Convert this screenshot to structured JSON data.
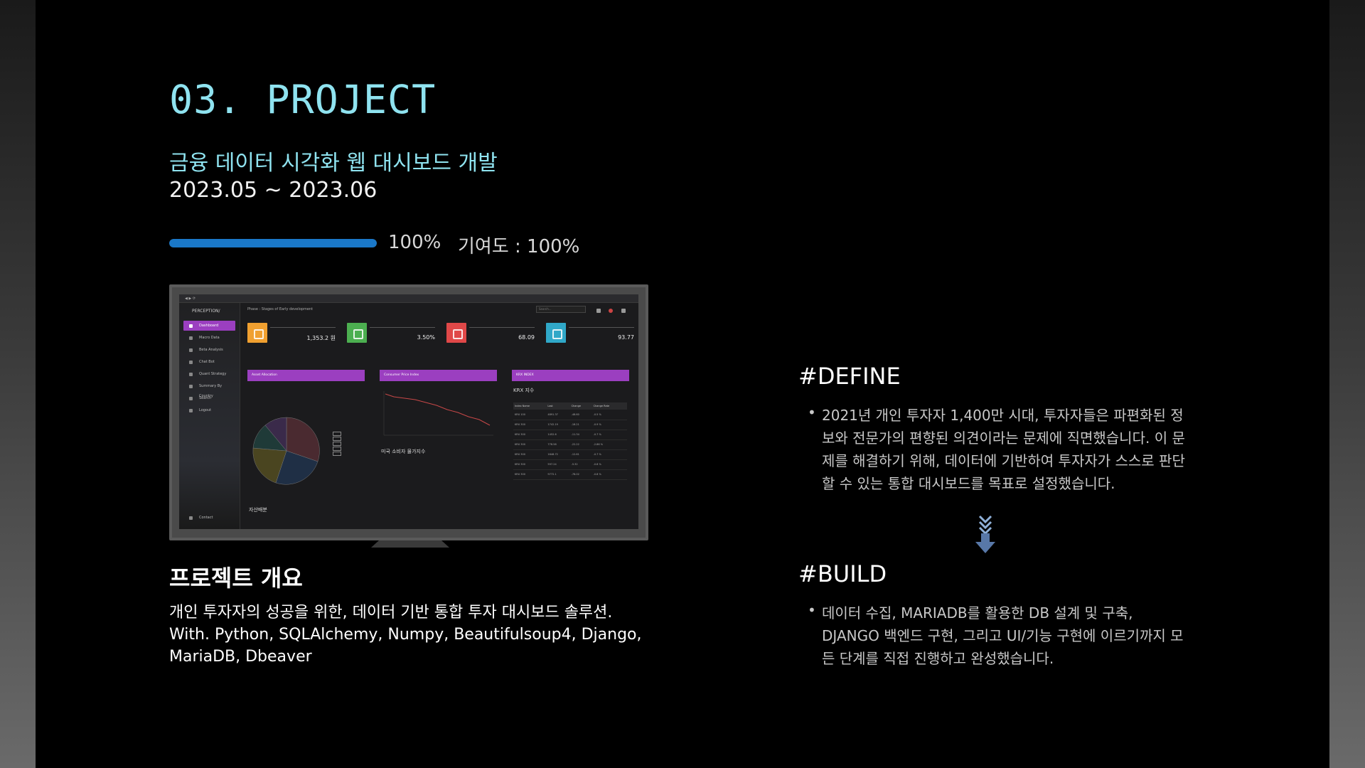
{
  "header": {
    "section_title": "03. PROJECT",
    "project_title": "금융 데이터 시각화 웹 대시보드 개발",
    "period": "2023.05 ~ 2023.06",
    "progress_fraction": 1.0,
    "progress_label": "100%",
    "contribution": "기여도 : 100%"
  },
  "screenshot": {
    "brand": "PERCEPTION/",
    "phase": "Phase : Stages of Early development",
    "search_placeholder": "Search...",
    "nav": [
      {
        "label": "Dashboard",
        "active": true
      },
      {
        "label": "Macro Data",
        "active": false
      },
      {
        "label": "Beta Analysis",
        "active": false
      },
      {
        "label": "Chat Bot",
        "active": false
      },
      {
        "label": "Quant Strategy",
        "active": false
      },
      {
        "label": "Summary By Country",
        "active": false
      },
      {
        "label": "Search",
        "active": false
      },
      {
        "label": "Logout",
        "active": false
      }
    ],
    "nav_contact": "Contact",
    "cards": [
      {
        "value": "1,353.2 원",
        "color": "#f0a030"
      },
      {
        "value": "3.50%",
        "color": "#4caf50"
      },
      {
        "value": "68.09",
        "color": "#e04848"
      },
      {
        "value": "93.77",
        "color": "#30a8c8"
      }
    ],
    "panels": {
      "asset_header": "Asset Allocation",
      "cpi_header": "Consumer Price Index",
      "krx_header": "KRX INDEX",
      "asset_caption": "자산배분",
      "cpi_caption": "미국 소비자 물가지수",
      "krx_caption": "KRX 지수",
      "krx_columns": [
        "Index Name",
        "Last",
        "Change",
        "Change Rate"
      ],
      "krx_rows": [
        [
          "KRX 100",
          "4891.37",
          "-48.60",
          "-0.5 %"
        ],
        [
          "KRX 300",
          "1742.19",
          "-18.21",
          "-0.9 %"
        ],
        [
          "KRX 300",
          "1452.6",
          "-11.34",
          "-0.7 %"
        ],
        [
          "KRX 300",
          "778.58",
          "-22.22",
          "-2.86 %"
        ],
        [
          "KRX 300",
          "1648.72",
          "-12.61",
          "-0.7 %"
        ],
        [
          "KRX 300",
          "597.24",
          "-5.32",
          "-0.8 %"
        ],
        [
          "KRX 300",
          "9772.1",
          "-78.02",
          "-0.8 %"
        ]
      ]
    }
  },
  "overview": {
    "title": "프로젝트 개요",
    "line1": "개인 투자자의 성공을 위한, 데이터 기반 통합 투자 대시보드 솔루션.",
    "line2": "With. Python, SQLAlchemy, Numpy, Beautifulsoup4, Django,",
    "line3": "MariaDB, Dbeaver"
  },
  "define": {
    "title": "#DEFINE",
    "text": "2021년 개인 투자자 1,400만 시대, 투자자들은 파편화된 정보와 전문가의 편향된 의견이라는 문제에 직면했습니다. 이 문제를 해결하기 위해, 데이터에 기반하여 투자자가 스스로 판단할 수 있는 통합 대시보드를 목표로 설정했습니다."
  },
  "build": {
    "title": "#BUILD",
    "text": "데이터 수집, MARIADB를 활용한 DB 설계 및 구축, DJANGO 백엔드 구현, 그리고 UI/기능 구현에 이르기까지 모든 단계를 직접 진행하고 완성했습니다."
  },
  "icons": {
    "arrow": "triple-chevron-down-icon",
    "bullet": "bullet-icon"
  },
  "colors": {
    "accent": "#8fe3f0",
    "progress": "#1a78c8",
    "panel_header": "#9b3fc0"
  }
}
